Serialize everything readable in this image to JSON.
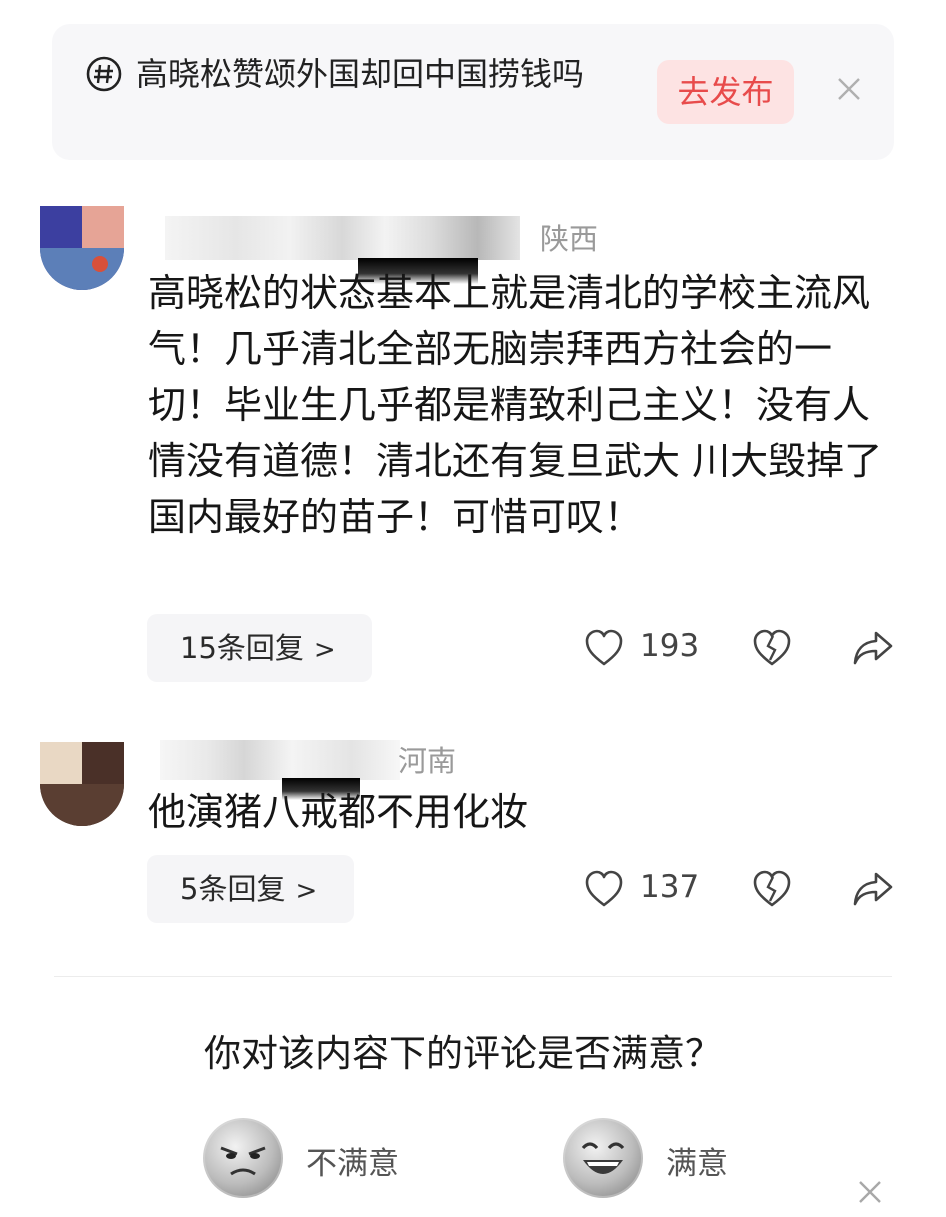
{
  "topic": {
    "text": "高晓松赞颂外国却回中国捞钱吗",
    "publish_label": "去发布",
    "hashtag_icon": "hashtag-icon",
    "close_icon": "close-icon"
  },
  "comments": [
    {
      "location": "陕西",
      "text": "高晓松的状态基本上就是清北的学校主流风气！几乎清北全部无脑崇拜西方社会的一切！毕业生几乎都是精致利己主义！没有人情没有道德！清北还有复旦武大 川大毁掉了国内最好的苗子！可惜可叹！",
      "replies_label": "15条回复",
      "likes": "193"
    },
    {
      "location": "河南",
      "text": "他演猪八戒都不用化妆",
      "replies_label": "5条回复",
      "likes": "137"
    }
  ],
  "survey": {
    "question": "你对该内容下的评论是否满意？",
    "unsatisfied_label": "不满意",
    "satisfied_label": "满意"
  },
  "colors": {
    "publish_bg": "#fde3e3",
    "publish_text": "#e84b4b",
    "card_bg": "#f7f7f9"
  }
}
